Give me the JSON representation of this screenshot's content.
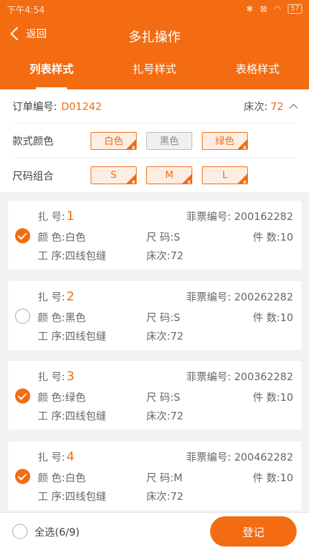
{
  "status": {
    "time": "下午4:54",
    "battery": "57"
  },
  "nav": {
    "back_label": "返回",
    "title": "多扎操作"
  },
  "tabs": [
    {
      "label": "列表样式",
      "active": true
    },
    {
      "label": "扎号样式",
      "active": false
    },
    {
      "label": "表格样式",
      "active": false
    }
  ],
  "order": {
    "label": "订单编号:",
    "value": "D01242",
    "bed_label": "床次:",
    "bed_value": "72"
  },
  "color_filter": {
    "label": "款式颜色",
    "chips": [
      "白色",
      "黑色",
      "绿色"
    ]
  },
  "size_filter": {
    "label": "尺码组合",
    "chips": [
      "S",
      "M",
      "L"
    ]
  },
  "card_labels": {
    "bundle": "扎 号:",
    "ticket": "菲票编号:",
    "color": "颜 色:",
    "size": "尺 码:",
    "count": "件 数:",
    "process": "工 序:",
    "bed": "床次:"
  },
  "cards": [
    {
      "bundle": "1",
      "ticket": "200162282",
      "color": "白色",
      "size": "S",
      "count": "10",
      "process": "四线包缝",
      "bed": "72",
      "checked": true
    },
    {
      "bundle": "2",
      "ticket": "200262282",
      "color": "黑色",
      "size": "S",
      "count": "10",
      "process": "四线包缝",
      "bed": "72",
      "checked": false
    },
    {
      "bundle": "3",
      "ticket": "200362282",
      "color": "绿色",
      "size": "S",
      "count": "10",
      "process": "四线包缝",
      "bed": "72",
      "checked": true
    },
    {
      "bundle": "4",
      "ticket": "200462282",
      "color": "白色",
      "size": "M",
      "count": "10",
      "process": "四线包缝",
      "bed": "72",
      "checked": true
    }
  ],
  "footer": {
    "select_all": "全选(6/9)",
    "submit": "登记"
  },
  "colors": {
    "accent": "#f36c12"
  }
}
